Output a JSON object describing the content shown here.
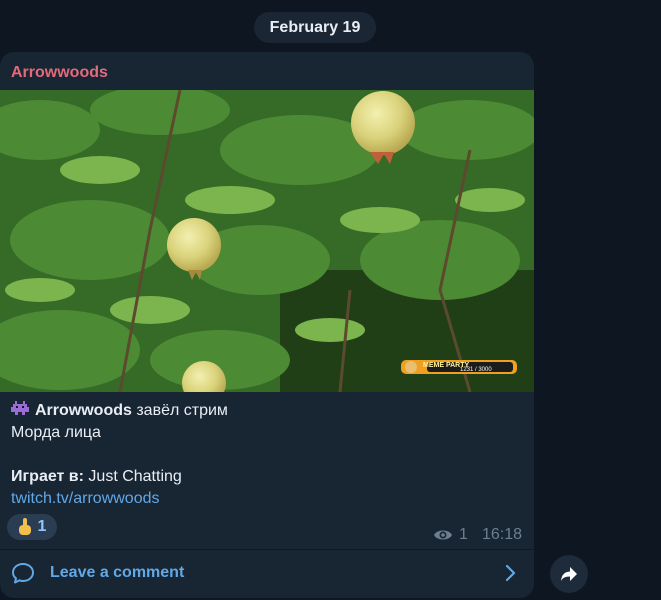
{
  "date_separator": "February 19",
  "message": {
    "sender": "Arrowwoods",
    "photo_overlay_labels": {
      "brand": "MEME PARTY",
      "counter": "1231 / 3000"
    },
    "line1": {
      "channel": "Arrowwoods",
      "action": " завёл стрим"
    },
    "line2": "Морда лица",
    "line4": {
      "label": "Играет в:",
      "value": " Just Chatting"
    },
    "link": "twitch.tv/arrowwoods",
    "reaction": {
      "icon": "hand-icon",
      "count": "1"
    },
    "views": "1",
    "time": "16:18"
  },
  "comment_bar": {
    "label": "Leave a comment"
  },
  "colors": {
    "background": "#0e1621",
    "bubble": "#182533",
    "sender": "#e36a7a",
    "link": "#62a8e6",
    "meta": "#6d7f8f"
  }
}
